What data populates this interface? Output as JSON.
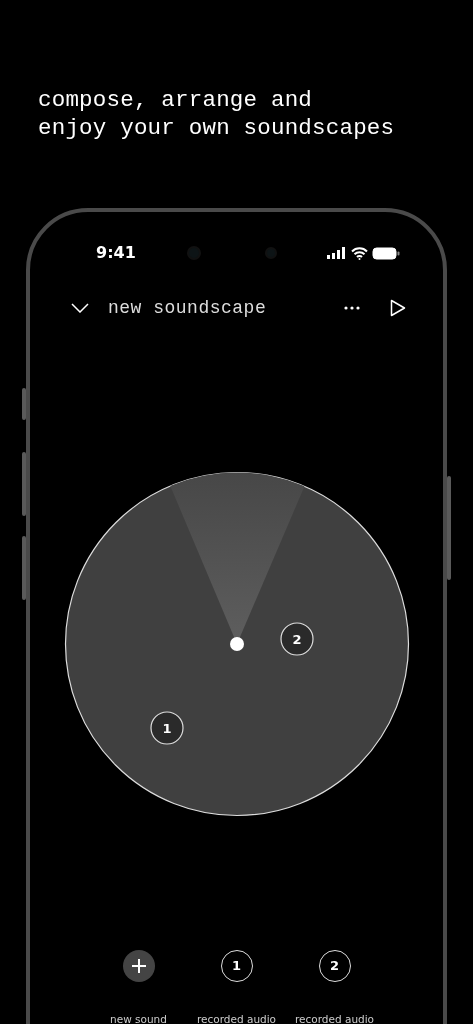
{
  "headline": "compose, arrange and\nenjoy your own soundscapes",
  "status_bar": {
    "time": "9:41"
  },
  "header": {
    "title": "new soundscape"
  },
  "canvas": {
    "sounds": [
      {
        "label": "1"
      },
      {
        "label": "2"
      }
    ]
  },
  "toolbar": [
    {
      "kind": "add",
      "label": "new sound"
    },
    {
      "kind": "sound",
      "number": "1",
      "label": "recorded audio"
    },
    {
      "kind": "sound",
      "number": "2",
      "label": "recorded audio"
    }
  ]
}
